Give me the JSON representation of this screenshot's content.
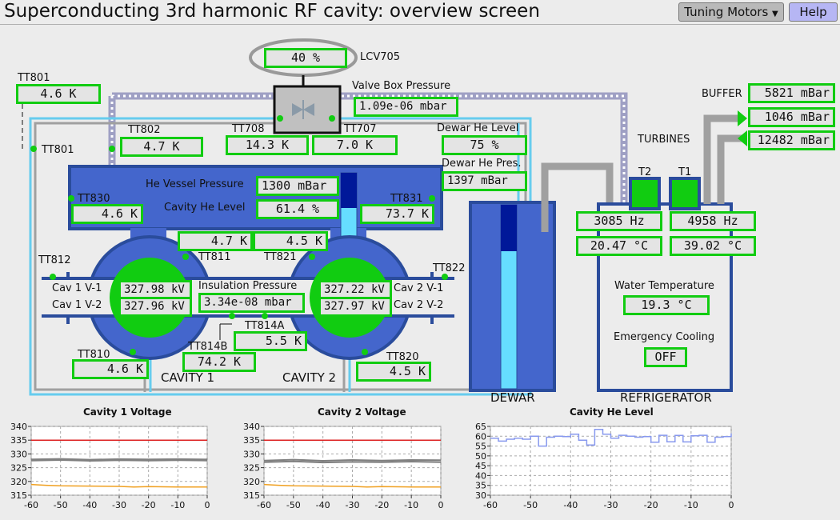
{
  "header": {
    "title": "Superconducting 3rd harmonic RF cavity: overview screen",
    "tuning_label": "Tuning Motors",
    "help_label": "Help"
  },
  "valve": {
    "percent": "40 %",
    "name": "LCV705",
    "box_pressure_label": "Valve Box Pressure",
    "box_pressure": "1.09e-06 mbar"
  },
  "sensors": {
    "tt801_top_label": "TT801",
    "tt801_top": "4.6 K",
    "tt801_side_label": "TT801",
    "tt802_label": "TT802",
    "tt802": "4.7 K",
    "tt708_label": "TT708",
    "tt708": "14.3 K",
    "tt707_label": "TT707",
    "tt707": "7.0 K",
    "tt830_label": "TT830",
    "tt830": "4.6 K",
    "tt831_label": "TT831",
    "tt831": "73.7 K",
    "tt811_label": "TT811",
    "tt811": "4.7 K",
    "tt821_label": "TT821",
    "tt821": "4.5 K",
    "tt812_label": "TT812",
    "tt822_label": "TT822",
    "tt814a_label": "TT814A",
    "tt814a": "5.5 K",
    "tt814b_label": "TT814B",
    "tt814b": "74.2 K",
    "tt810_label": "TT810",
    "tt810": "4.6 K",
    "tt820_label": "TT820",
    "tt820": "4.5 K"
  },
  "dewar": {
    "level_label": "Dewar He Level",
    "level": "75 %",
    "pres_label": "Dewar He Pres.",
    "pres": "1397 mBar",
    "name": "DEWAR",
    "fill_fraction": 0.75
  },
  "vessel": {
    "pressure_label": "He Vessel Pressure",
    "pressure": "1300 mBar",
    "level_label": "Cavity He Level",
    "level": "61.4 %",
    "fill_fraction": 0.61
  },
  "cavities": {
    "cav1_v1_label": "Cav 1 V-1",
    "cav1_v1": "327.98 kV",
    "cav1_v2_label": "Cav 1 V-2",
    "cav1_v2": "327.96 kV",
    "cav2_v1_label": "Cav 2 V-1",
    "cav2_v1": "327.22 kV",
    "cav2_v2_label": "Cav 2 V-2",
    "cav2_v2": "327.97 kV",
    "insulation_label": "Insulation Pressure",
    "insulation": "3.34e-08 mbar",
    "cav1_name": "CAVITY 1",
    "cav2_name": "CAVITY 2"
  },
  "refrigerator": {
    "buffer_label": "BUFFER",
    "buffer": "5821 mBar",
    "p2": "1046 mBar",
    "p3": "12482 mBar",
    "turbines_label": "TURBINES",
    "t2_label": "T2",
    "t1_label": "T1",
    "t2_freq": "3085 Hz",
    "t1_freq": "4958 Hz",
    "t2_temp": "20.47 °C",
    "t1_temp": "39.02 °C",
    "water_label": "Water Temperature",
    "water": "19.3 °C",
    "emergency_label": "Emergency Cooling",
    "emergency": "OFF",
    "name": "REFRIGERATOR"
  },
  "colors": {
    "readout_border": "#11cc11",
    "vessel": "#4466cc",
    "vessel_dark": "#2a4c9c",
    "pipe": "#a0a0a0",
    "helium": "#66ddff",
    "setpoint": "#dd2222",
    "lower_trace": "#f0a020",
    "he_trace": "#8899ee"
  },
  "chart_data": [
    {
      "type": "line",
      "title": "Cavity 1 Voltage",
      "xlim": [
        -60,
        0
      ],
      "ylim": [
        315,
        340
      ],
      "xticks": [
        "-60",
        "-50",
        "-40",
        "-30",
        "-20",
        "-10",
        "0"
      ],
      "yticks": [
        "340",
        "335",
        "330",
        "325",
        "320",
        "315"
      ],
      "series": [
        {
          "color": "#dd2222",
          "x": [
            -60,
            0
          ],
          "y": [
            335,
            335
          ]
        },
        {
          "color": "#808080",
          "x": [
            -60,
            -50,
            -40,
            -30,
            -20,
            -10,
            0
          ],
          "y": [
            328.0,
            328.2,
            327.9,
            328.1,
            328.0,
            328.1,
            328.0
          ]
        },
        {
          "color": "#808080",
          "x": [
            -60,
            -50,
            -40,
            -30,
            -20,
            -10,
            0
          ],
          "y": [
            327.6,
            327.8,
            327.5,
            327.7,
            327.6,
            327.7,
            327.6
          ]
        },
        {
          "color": "#f0a020",
          "x": [
            -60,
            -55,
            -50,
            -40,
            -30,
            -25,
            -20,
            -10,
            0
          ],
          "y": [
            318.9,
            318.6,
            318.4,
            318.3,
            318.2,
            318.0,
            318.1,
            318.0,
            318.0
          ]
        }
      ]
    },
    {
      "type": "line",
      "title": "Cavity 2 Voltage",
      "xlim": [
        -60,
        0
      ],
      "ylim": [
        315,
        340
      ],
      "xticks": [
        "-60",
        "-50",
        "-40",
        "-30",
        "-20",
        "-10",
        "0"
      ],
      "yticks": [
        "340",
        "335",
        "330",
        "325",
        "320",
        "315"
      ],
      "series": [
        {
          "color": "#dd2222",
          "x": [
            -60,
            0
          ],
          "y": [
            335,
            335
          ]
        },
        {
          "color": "#808080",
          "x": [
            -60,
            -50,
            -40,
            -30,
            -20,
            -10,
            0
          ],
          "y": [
            327.6,
            327.9,
            327.5,
            327.8,
            327.6,
            327.8,
            327.7
          ]
        },
        {
          "color": "#808080",
          "x": [
            -60,
            -50,
            -40,
            -30,
            -20,
            -10,
            0
          ],
          "y": [
            327.0,
            327.3,
            326.9,
            327.1,
            327.0,
            327.2,
            327.0
          ]
        },
        {
          "color": "#f0a020",
          "x": [
            -60,
            -55,
            -50,
            -40,
            -30,
            -25,
            -20,
            -10,
            0
          ],
          "y": [
            318.9,
            318.6,
            318.4,
            318.3,
            318.2,
            318.0,
            318.1,
            318.0,
            318.0
          ]
        }
      ]
    },
    {
      "type": "line",
      "title": "Cavity He Level",
      "xlim": [
        -60,
        0
      ],
      "ylim": [
        30,
        65
      ],
      "xticks": [
        "-60",
        "-50",
        "-40",
        "-30",
        "-20",
        "-10",
        "0"
      ],
      "yticks": [
        "65",
        "60",
        "55",
        "50",
        "45",
        "40",
        "35",
        "30"
      ],
      "series": [
        {
          "color": "#8899ee",
          "x": [
            -60,
            -58,
            -56,
            -54,
            -52,
            -50,
            -48,
            -46,
            -44,
            -42,
            -40,
            -38,
            -36,
            -34,
            -32,
            -30,
            -28,
            -26,
            -24,
            -22,
            -20,
            -18,
            -16,
            -14,
            -12,
            -10,
            -8,
            -6,
            -4,
            -2,
            0
          ],
          "y": [
            59,
            57.5,
            58.5,
            59,
            58.5,
            60,
            55,
            59.5,
            60,
            59.8,
            61,
            58,
            55.5,
            63.5,
            61,
            59,
            60.5,
            60,
            59.5,
            59.8,
            57,
            60.5,
            57.2,
            60.4,
            57.1,
            60.2,
            60.5,
            57,
            59.5,
            59.8,
            61.4
          ]
        }
      ]
    }
  ]
}
